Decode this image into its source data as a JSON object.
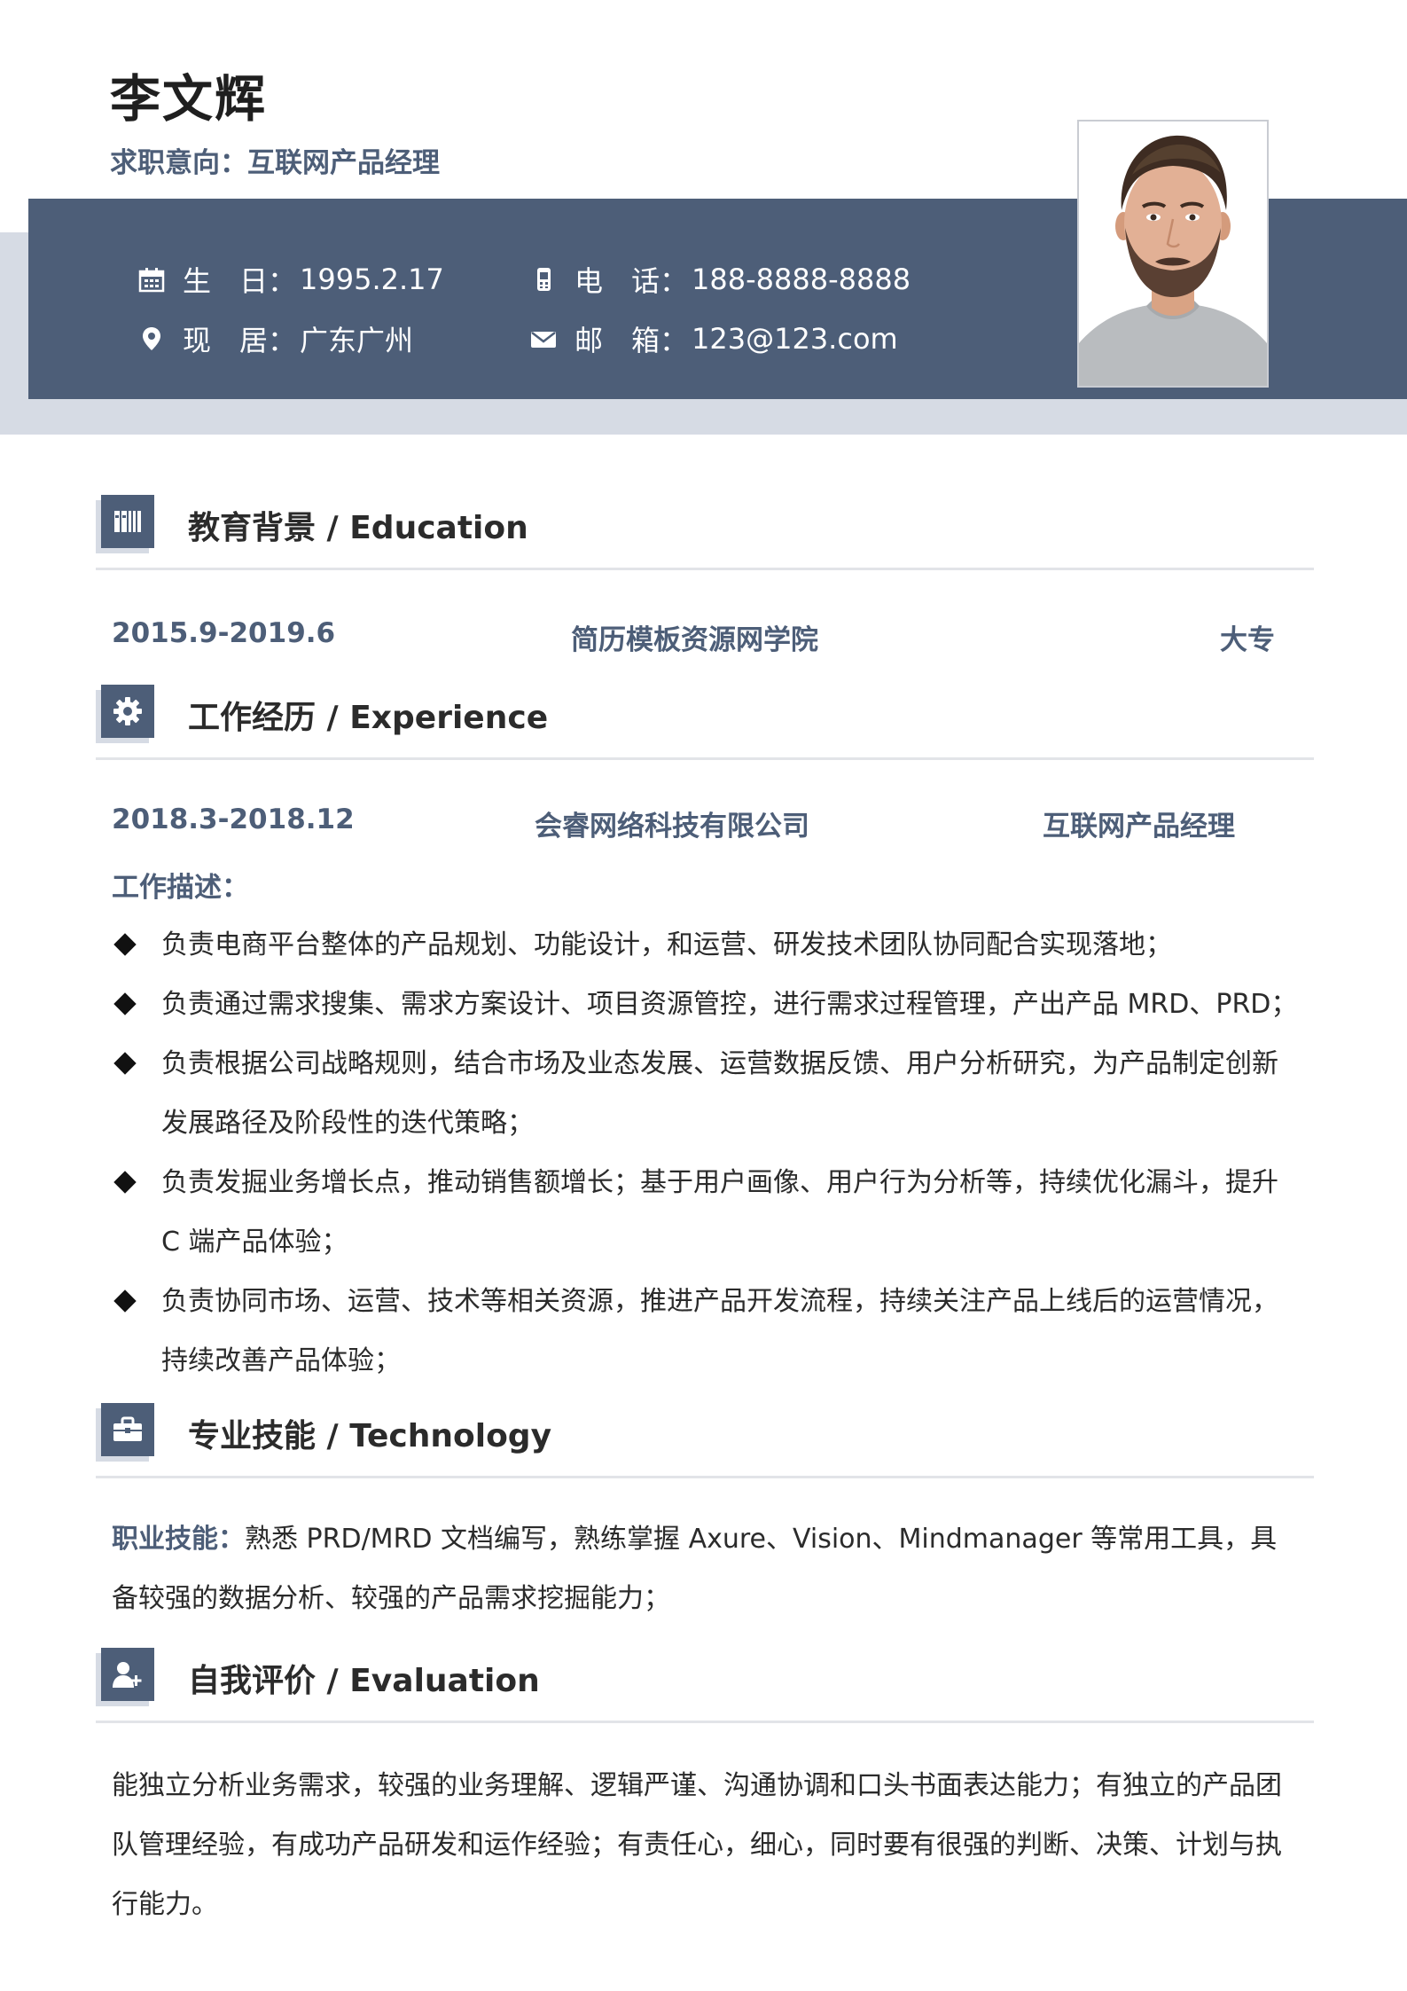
{
  "header": {
    "name": "李文辉",
    "intent": "求职意向：互联网产品经理"
  },
  "info": {
    "birth_label": "生　日：",
    "birth_value": "1995.2.17",
    "phone_label": "电　话：",
    "phone_value": "188-8888-8888",
    "residence_label": "现　居：",
    "residence_value": "广东广州",
    "email_label": "邮　箱：",
    "email_value": "123@123.com"
  },
  "colors": {
    "accent": "#4d5e78",
    "accent_light": "#d6dbe4",
    "rule": "#e2e4e8"
  },
  "education": {
    "title": "教育背景 / Education",
    "icon": "books-icon",
    "period": "2015.9-2019.6",
    "school": "简历模板资源网学院",
    "degree": "大专"
  },
  "experience": {
    "title": "工作经历 / Experience",
    "icon": "gear-icon",
    "period": "2018.3-2018.12",
    "company": "会睿网络科技有限公司",
    "position": "互联网产品经理",
    "desc_label": "工作描述：",
    "bullets": [
      "负责电商平台整体的产品规划、功能设计，和运营、研发技术团队协同配合实现落地；",
      "负责通过需求搜集、需求方案设计、项目资源管控，进行需求过程管理，产出产品 MRD、PRD；",
      "负责根据公司战略规则，结合市场及业态发展、运营数据反馈、用户分析研究，为产品制定创新发展路径及阶段性的迭代策略；",
      "负责发掘业务增长点，推动销售额增长；基于用户画像、用户行为分析等，持续优化漏斗，提升 C 端产品体验；",
      "负责协同市场、运营、技术等相关资源，推进产品开发流程，持续关注产品上线后的运营情况，持续改善产品体验；"
    ]
  },
  "skills": {
    "title": "专业技能 / Technology",
    "icon": "briefcase-icon",
    "label": "职业技能：",
    "text": "熟悉 PRD/MRD 文档编写，熟练掌握 Axure、Vision、Mindmanager 等常用工具，具备较强的数据分析、较强的产品需求挖掘能力；"
  },
  "evaluation": {
    "title": "自我评价 / Evaluation",
    "icon": "user-plus-icon",
    "text": "能独立分析业务需求，较强的业务理解、逻辑严谨、沟通协调和口头书面表达能力；有独立的产品团队管理经验，有成功产品研发和运作经验；有责任心，细心，同时要有很强的判断、决策、计划与执行能力。"
  }
}
